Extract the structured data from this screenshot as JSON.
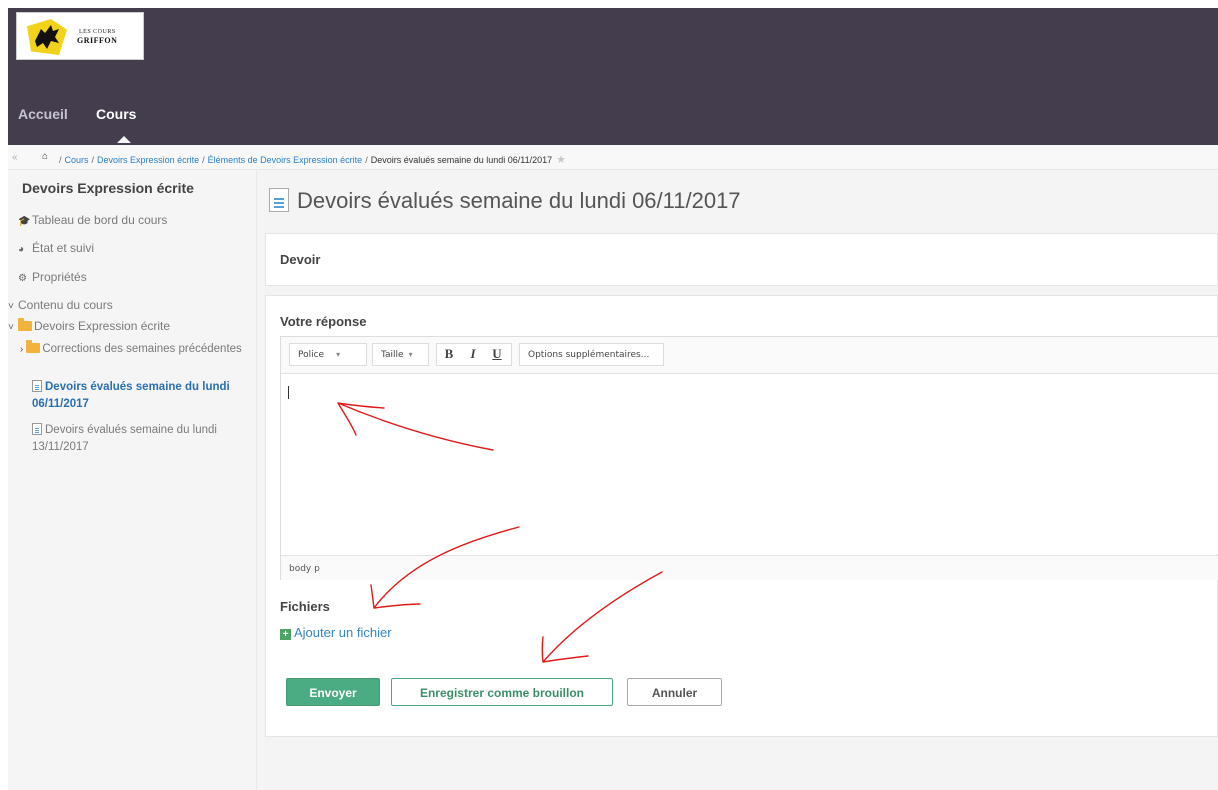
{
  "header": {
    "logo": {
      "line1": "LES COURS",
      "line2": "GRIFFON"
    },
    "nav": [
      {
        "label": "Accueil"
      },
      {
        "label": "Cours"
      }
    ]
  },
  "breadcrumb": {
    "items": [
      "Cours",
      "Devoirs Expression écrite",
      "Éléments de Devoirs Expression écrite"
    ],
    "current": "Devoirs évalués semaine du lundi 06/11/2017"
  },
  "sidebar": {
    "title": "Devoirs Expression écrite",
    "items": [
      {
        "label": "Tableau de bord du cours",
        "icon": "graduation-cap-icon"
      },
      {
        "label": "État et suivi",
        "icon": "pie-chart-icon"
      },
      {
        "label": "Propriétés",
        "icon": "gear-icon"
      }
    ],
    "tree": {
      "root": "Contenu du cours",
      "folder": "Devoirs Expression écrite",
      "subfolder": "Corrections des semaines précédentes",
      "active": "Devoirs évalués semaine du lundi 06/11/2017",
      "next": "Devoirs évalués semaine du lundi 13/11/2017"
    }
  },
  "main": {
    "title": "Devoirs évalués semaine du lundi 06/11/2017",
    "section": "Devoir",
    "response_label": "Votre réponse",
    "editor": {
      "font_label": "Police",
      "size_label": "Taille",
      "bold": "B",
      "italic": "I",
      "underline": "U",
      "more_options": "Options supplémentaires...",
      "status_path": "body p"
    },
    "files_label": "Fichiers",
    "add_file": "Ajouter un fichier",
    "buttons": {
      "send": "Envoyer",
      "draft": "Enregistrer comme brouillon",
      "cancel": "Annuler"
    }
  },
  "colors": {
    "header_bg": "#433d4d",
    "accent_green": "#4bab82",
    "link_blue": "#2a6fb0",
    "annotation_red": "#e01b1b"
  }
}
